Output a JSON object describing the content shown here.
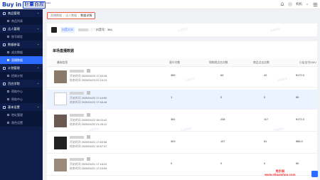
{
  "brand": {
    "en": "Buy in",
    "cn": "巨量百应",
    "beta": "beta"
  },
  "header": {
    "user_name": "机机"
  },
  "sidebar": [
    {
      "group": "商品管理",
      "items": [
        "商品列表"
      ]
    },
    {
      "group": "达人管理",
      "items": [
        "账号绑定"
      ]
    },
    {
      "group": "数据参谋",
      "items": [
        "成交数据",
        "直播数据"
      ]
    },
    {
      "group": "计划管理",
      "items": [
        "招商计划"
      ]
    },
    {
      "group": "百应学院",
      "items": [
        "帮助中心",
        "帮助中心"
      ]
    },
    {
      "group": "基本设置",
      "items": [
        "地址管理",
        "角色设置"
      ]
    }
  ],
  "active_item": "直播数据",
  "breadcrumb": [
    "直播数据",
    "达人数据",
    "数据详情"
  ],
  "room": {
    "tag": "抖音大众",
    "id_label": "抖音号：384"
  },
  "table": {
    "title": "单场直播数据",
    "headers": [
      "基础信息",
      "观众次数",
      "购物袋点击次数",
      "商品点击次数",
      "小店支付GMV"
    ],
    "start_label": "开始时间",
    "end_label": "结束时间",
    "rows": [
      {
        "start": "2020/04/23 17:50:26",
        "end": "2020/04/23 20:19:13",
        "viewers": "389",
        "bag_clicks": "64",
        "product_clicks": "42",
        "gmv": "¥172.0"
      },
      {
        "start": "2020/04/23 17:44:50",
        "end": "2020/04/23 17:46:48",
        "viewers": "1",
        "bag_clicks": "0",
        "product_clicks": "0",
        "gmv": "¥0"
      },
      {
        "start": "2020/04/22 18:03:42",
        "end": "2020/04/22 21:26:12",
        "viewers": "381",
        "bag_clicks": "238",
        "product_clicks": "117",
        "gmv": "¥172.0"
      },
      {
        "start": "2020/04/21 17:50:56",
        "end": "2020/04/21 19:57:07",
        "viewers": "309",
        "bag_clicks": "137",
        "product_clicks": "61",
        "gmv": "¥86.0"
      },
      {
        "start": "2020/04/21 17:18:20",
        "end": "2020/04/21 17:24:59",
        "viewers": "0",
        "bag_clicks": "0",
        "product_clicks": "0",
        "gmv": "¥0"
      }
    ]
  },
  "watermark_text": "抖音百应",
  "site_watermark": {
    "line1": "甩手网",
    "line2": "www.shuaishou.com"
  },
  "colors": {
    "sidebar_bg": "#0f1d4a",
    "accent": "#2c6bff",
    "highlight": "#e8593f"
  }
}
